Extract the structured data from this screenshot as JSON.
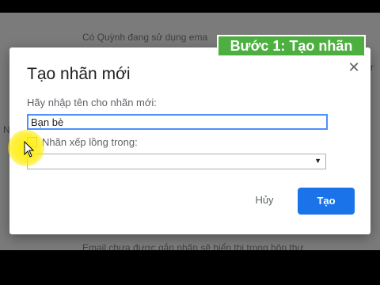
{
  "background": {
    "top_text": "Có Quỳnh đang sử dụng ema",
    "bottom_text": "Email chưa được gắn nhãn sẽ hiển thị trong hộp thư",
    "left_text": "N",
    "right_text": "r"
  },
  "step_badge": {
    "label": "Bước 1: Tạo nhãn",
    "color": "#4caf3f"
  },
  "dialog": {
    "title": "Tạo nhãn mới",
    "close_icon": "close-icon",
    "name_label": "Hãy nhập tên cho nhãn mới:",
    "name_value": "Bạn bè",
    "nest_label": "Nhãn xếp lồng trong:",
    "nest_checked": false,
    "parent_select_value": "",
    "cancel_label": "Hủy",
    "create_label": "Tạo",
    "accent_color": "#1a73e8"
  },
  "pointer": {
    "icon": "mouse-pointer-icon",
    "highlight_color": "#ffeb00"
  }
}
